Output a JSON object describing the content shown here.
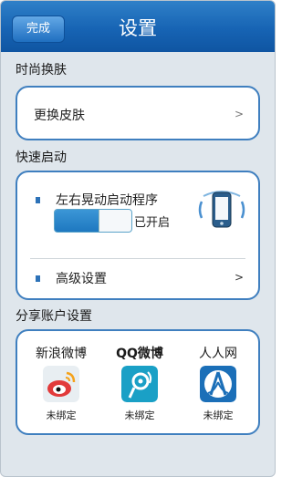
{
  "header": {
    "back_label": "完成",
    "title": "设置"
  },
  "skin": {
    "section_title": "时尚换肤",
    "row_label": "更换皮肤",
    "chevron": ">"
  },
  "quick_start": {
    "section_title": "快速启动",
    "shake_label": "左右晃动启动程序",
    "status": "已开启",
    "advanced_label": "高级设置",
    "chevron": ">"
  },
  "share": {
    "section_title": "分享账户设置",
    "accounts": [
      {
        "name": "新浪微博",
        "status": "未绑定",
        "icon": "sina-weibo-icon"
      },
      {
        "name": "QQ微博",
        "status": "未绑定",
        "icon": "qq-weibo-icon"
      },
      {
        "name": "人人网",
        "status": "未绑定",
        "icon": "renren-icon"
      }
    ]
  },
  "colors": {
    "header": "#1764b4",
    "accent": "#3f7fbf",
    "background": "#dfe6ec"
  }
}
